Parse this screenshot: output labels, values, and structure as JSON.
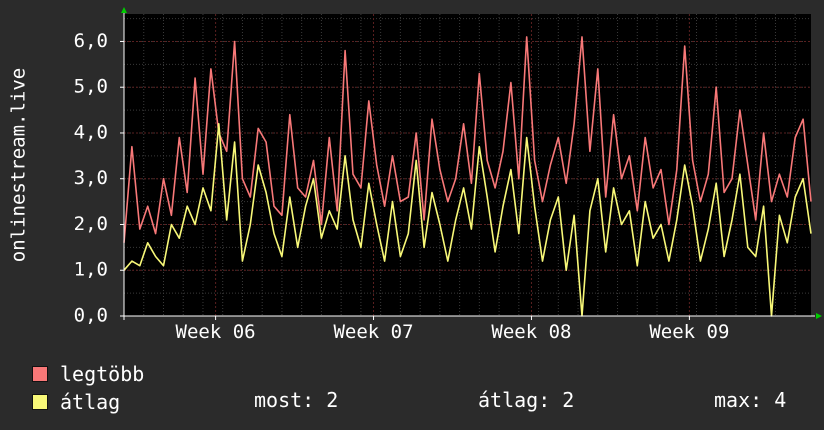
{
  "colors": {
    "background": "#2b2b2b",
    "canvas": "#000000",
    "grid_major": "#5a1f1f",
    "grid_minor": "#3a3a3a",
    "axis": "#ffffff",
    "arrow": "#00cc00",
    "max_series": "#f87878",
    "avg_series": "#f8f878"
  },
  "chart_data": {
    "type": "line",
    "ylabel": "onlinestream.live",
    "ylim": [
      0,
      6.6
    ],
    "yticks": [
      0,
      1,
      2,
      3,
      4,
      5,
      6
    ],
    "ytick_labels": [
      "0,0",
      "1,0",
      "2,0",
      "3,0",
      "4,0",
      "5,0",
      "6,0"
    ],
    "xlim": [
      0,
      4.35
    ],
    "xticks": [
      {
        "label": "Week 06",
        "pos": 0.58
      },
      {
        "label": "Week 07",
        "pos": 1.58
      },
      {
        "label": "Week 08",
        "pos": 2.58
      },
      {
        "label": "Week 09",
        "pos": 3.58
      }
    ],
    "grid": true,
    "series": [
      {
        "name": "legtöbb",
        "color": "#f87878",
        "x": [
          0.0,
          0.05,
          0.1,
          0.15,
          0.2,
          0.25,
          0.3,
          0.35,
          0.4,
          0.45,
          0.5,
          0.55,
          0.6,
          0.65,
          0.7,
          0.75,
          0.8,
          0.85,
          0.9,
          0.95,
          1.0,
          1.05,
          1.1,
          1.15,
          1.2,
          1.25,
          1.3,
          1.35,
          1.4,
          1.45,
          1.5,
          1.55,
          1.6,
          1.65,
          1.7,
          1.75,
          1.8,
          1.85,
          1.9,
          1.95,
          2.0,
          2.05,
          2.1,
          2.15,
          2.2,
          2.25,
          2.3,
          2.35,
          2.4,
          2.45,
          2.5,
          2.55,
          2.6,
          2.65,
          2.7,
          2.75,
          2.8,
          2.85,
          2.9,
          2.95,
          3.0,
          3.05,
          3.1,
          3.15,
          3.2,
          3.25,
          3.3,
          3.35,
          3.4,
          3.45,
          3.5,
          3.55,
          3.6,
          3.65,
          3.7,
          3.75,
          3.8,
          3.85,
          3.9,
          3.95,
          4.0,
          4.05,
          4.1,
          4.15,
          4.2,
          4.25,
          4.3,
          4.35
        ],
        "values": [
          1.6,
          3.7,
          1.9,
          2.4,
          1.8,
          3.0,
          2.2,
          3.9,
          2.7,
          5.2,
          3.1,
          5.4,
          4.0,
          3.6,
          6.0,
          3.0,
          2.6,
          4.1,
          3.8,
          2.4,
          2.2,
          4.4,
          2.8,
          2.6,
          3.4,
          2.0,
          3.9,
          2.3,
          5.8,
          3.1,
          2.8,
          4.7,
          3.3,
          2.4,
          3.5,
          2.5,
          2.6,
          4.0,
          2.1,
          4.3,
          3.2,
          2.5,
          3.0,
          4.2,
          2.9,
          5.3,
          3.4,
          2.8,
          3.6,
          5.1,
          3.0,
          6.1,
          3.4,
          2.5,
          3.3,
          3.9,
          2.9,
          4.2,
          6.1,
          3.6,
          5.4,
          2.6,
          4.4,
          3.0,
          3.5,
          2.3,
          3.9,
          2.8,
          3.2,
          2.0,
          3.2,
          5.9,
          3.4,
          2.5,
          3.1,
          5.0,
          2.7,
          3.0,
          4.5,
          3.3,
          2.1,
          4.0,
          2.5,
          3.1,
          2.6,
          3.9,
          4.3,
          2.5
        ]
      },
      {
        "name": "átlag",
        "color": "#f8f878",
        "x": [
          0.0,
          0.05,
          0.1,
          0.15,
          0.2,
          0.25,
          0.3,
          0.35,
          0.4,
          0.45,
          0.5,
          0.55,
          0.6,
          0.65,
          0.7,
          0.75,
          0.8,
          0.85,
          0.9,
          0.95,
          1.0,
          1.05,
          1.1,
          1.15,
          1.2,
          1.25,
          1.3,
          1.35,
          1.4,
          1.45,
          1.5,
          1.55,
          1.6,
          1.65,
          1.7,
          1.75,
          1.8,
          1.85,
          1.9,
          1.95,
          2.0,
          2.05,
          2.1,
          2.15,
          2.2,
          2.25,
          2.3,
          2.35,
          2.4,
          2.45,
          2.5,
          2.55,
          2.6,
          2.65,
          2.7,
          2.75,
          2.8,
          2.85,
          2.9,
          2.95,
          3.0,
          3.05,
          3.1,
          3.15,
          3.2,
          3.25,
          3.3,
          3.35,
          3.4,
          3.45,
          3.5,
          3.55,
          3.6,
          3.65,
          3.7,
          3.75,
          3.8,
          3.85,
          3.9,
          3.95,
          4.0,
          4.05,
          4.1,
          4.15,
          4.2,
          4.25,
          4.3,
          4.35
        ],
        "values": [
          1.0,
          1.2,
          1.1,
          1.6,
          1.3,
          1.1,
          2.0,
          1.7,
          2.4,
          2.0,
          2.8,
          2.3,
          4.2,
          2.1,
          3.8,
          1.2,
          2.0,
          3.3,
          2.7,
          1.8,
          1.3,
          2.6,
          1.5,
          2.4,
          3.0,
          1.7,
          2.3,
          1.9,
          3.5,
          2.1,
          1.5,
          2.9,
          2.0,
          1.2,
          2.5,
          1.3,
          1.8,
          3.4,
          1.5,
          2.7,
          2.0,
          1.2,
          2.1,
          2.8,
          1.9,
          3.7,
          2.6,
          1.4,
          2.4,
          3.2,
          1.8,
          3.9,
          2.4,
          1.2,
          2.1,
          2.6,
          1.0,
          2.2,
          0.0,
          2.3,
          3.0,
          1.4,
          2.8,
          2.0,
          2.3,
          1.1,
          2.5,
          1.7,
          2.0,
          1.2,
          2.1,
          3.3,
          2.4,
          1.2,
          1.9,
          2.9,
          1.3,
          2.1,
          3.1,
          1.5,
          1.3,
          2.4,
          0.0,
          2.2,
          1.6,
          2.6,
          3.0,
          1.8
        ]
      }
    ]
  },
  "legend": {
    "items": [
      {
        "label": "legtöbb",
        "color": "#f87878"
      },
      {
        "label": "átlag",
        "color": "#f8f878"
      }
    ],
    "stats": {
      "now": "most: 2",
      "avg": "átlag: 2",
      "max": "max: 4"
    }
  }
}
